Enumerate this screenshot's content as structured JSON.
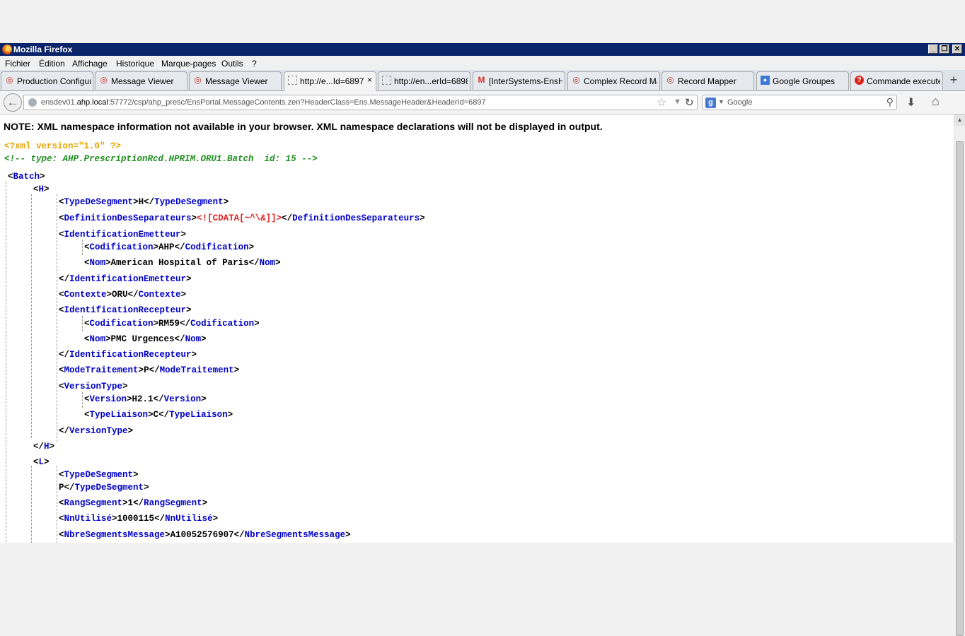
{
  "window": {
    "title": "Mozilla Firefox",
    "minimize": "_",
    "restore": "❐",
    "close": "✕"
  },
  "menu": [
    "Fichier",
    "Édition",
    "Affichage",
    "Historique",
    "Marque-pages",
    "Outils",
    "?"
  ],
  "tabs": [
    {
      "label": "Production Configur...",
      "icon": "app-icon"
    },
    {
      "label": "Message Viewer",
      "icon": "app-icon"
    },
    {
      "label": "Message Viewer",
      "icon": "app-icon"
    },
    {
      "label": "http://e...Id=6897",
      "icon": "page-icon"
    },
    {
      "label": "http://en...erId=6898",
      "icon": "page-icon"
    },
    {
      "label": "[InterSystems-EnsH...",
      "icon": "gmail-icon"
    },
    {
      "label": "Complex Record Ma...",
      "icon": "app-icon"
    },
    {
      "label": "Record Mapper",
      "icon": "app-icon"
    },
    {
      "label": "Google Groupes",
      "icon": "groups-icon"
    },
    {
      "label": "Commande execute...",
      "icon": "help-icon"
    }
  ],
  "active_tab_close": "×",
  "new_tab": "+",
  "nav": {
    "url_host_prefix": "ensdev01.",
    "url_host": "ahp.local",
    "url_rest": ":57772/csp/ahp_presc/EnsPortal.MessageContents.zen?HeaderClass=Ens.MessageHeader&HeaderId=6897",
    "search_placeholder": "Google"
  },
  "note": "NOTE: XML namespace information not available in your browser. XML namespace declarations will not be displayed in output.",
  "xml": {
    "pi": "<?xml version=\"1.0\" ?>",
    "comment": "<!-- type: AHP.PrescriptionRcd.HPRIM.ORU1.Batch  id: 15 -->",
    "lines": [
      {
        "indent": 0,
        "open": "Batch"
      },
      {
        "indent": 1,
        "open": "H"
      },
      {
        "indent": 2,
        "open": "TypeDeSegment",
        "text": "H",
        "close": "TypeDeSegment"
      },
      {
        "indent": 2,
        "open": "DefinitionDesSeparateurs",
        "cdata": "<![CDATA[~^\\&]]>",
        "close": "DefinitionDesSeparateurs"
      },
      {
        "indent": 2,
        "open": "IdentificationEmetteur"
      },
      {
        "indent": 3,
        "open": "Codification",
        "text": "AHP",
        "close": "Codification"
      },
      {
        "indent": 3,
        "open": "Nom",
        "text": "American Hospital of Paris",
        "close": "Nom"
      },
      {
        "indent": 2,
        "close": "IdentificationEmetteur"
      },
      {
        "indent": 2,
        "open": "Contexte",
        "text": "ORU",
        "close": "Contexte"
      },
      {
        "indent": 2,
        "open": "IdentificationRecepteur"
      },
      {
        "indent": 3,
        "open": "Codification",
        "text": "RM59",
        "close": "Codification"
      },
      {
        "indent": 3,
        "open": "Nom",
        "text": "PMC Urgences",
        "close": "Nom"
      },
      {
        "indent": 2,
        "close": "IdentificationRecepteur"
      },
      {
        "indent": 2,
        "open": "ModeTraitement",
        "text": "P",
        "close": "ModeTraitement"
      },
      {
        "indent": 2,
        "open": "VersionType"
      },
      {
        "indent": 3,
        "open": "Version",
        "text": "H2.1",
        "close": "Version"
      },
      {
        "indent": 3,
        "open": "TypeLiaison",
        "text": "C",
        "close": "TypeLiaison"
      },
      {
        "indent": 2,
        "close": "VersionType"
      },
      {
        "indent": 1,
        "close": "H"
      },
      {
        "indent": 1,
        "open": "L"
      },
      {
        "indent": 2,
        "open": "TypeDeSegment"
      },
      {
        "indent": 2,
        "text": "P",
        "close": "TypeDeSegment"
      },
      {
        "indent": 2,
        "open": "RangSegment",
        "text": "1",
        "close": "RangSegment"
      },
      {
        "indent": 2,
        "open": "NnUtilisé",
        "text": "1000115",
        "close": "NnUtilisé"
      },
      {
        "indent": 2,
        "open": "NbreSegmentsMessage",
        "text": "A10052576907",
        "close": "NbreSegmentsMessage"
      }
    ]
  },
  "scrollbar": {
    "up": "▲"
  }
}
